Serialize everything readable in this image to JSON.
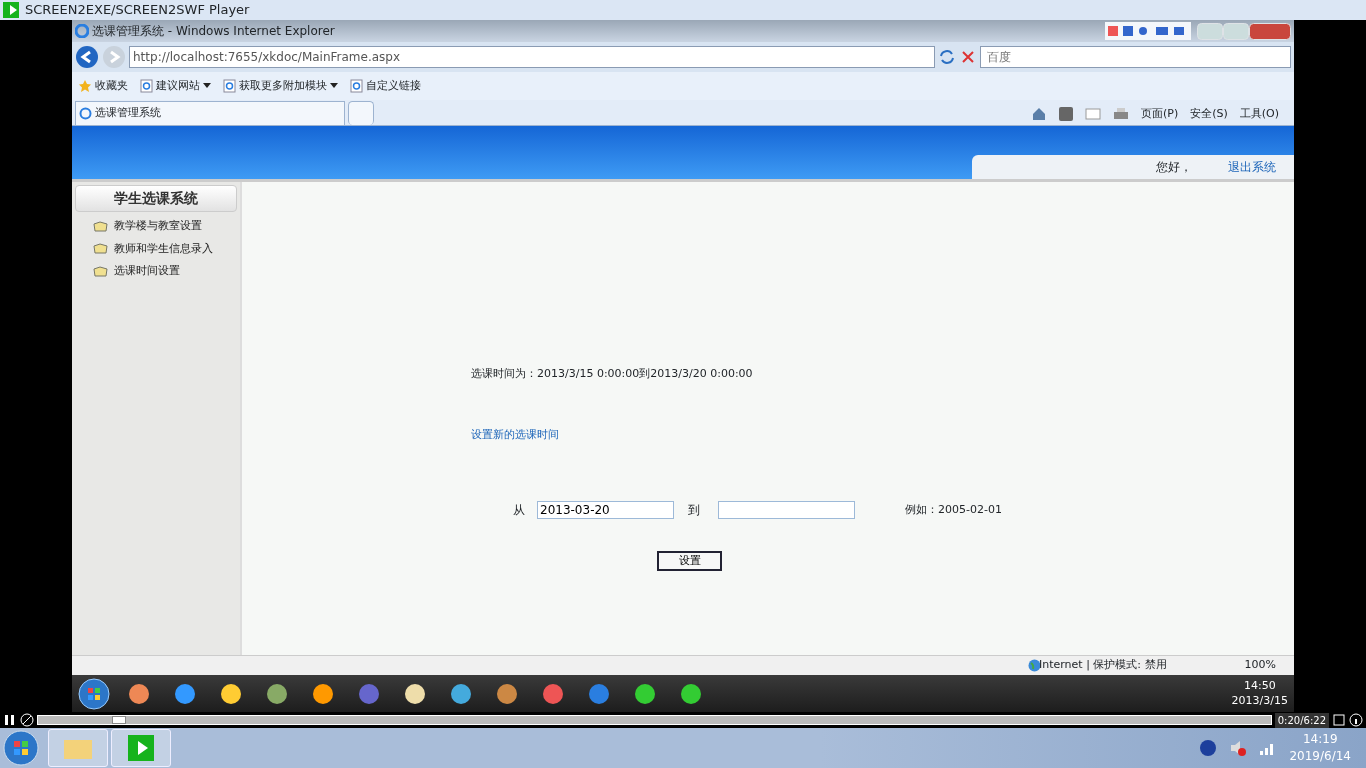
{
  "player": {
    "title": "SCREEN2EXE/SCREEN2SWF Player",
    "progress": {
      "level": 0.06
    },
    "time": "0:20/6:22"
  },
  "browser": {
    "title": "选课管理系统 - Windows Internet Explorer",
    "url": "http://localhost:7655/xkdoc/MainFrame.aspx",
    "search": {
      "placeholder": "百度"
    },
    "favorites": [
      {
        "label": "收藏夹",
        "kind": "star"
      },
      {
        "label": "建议网站",
        "kind": "dropdown"
      },
      {
        "label": "获取更多附加模块",
        "kind": "dropdown"
      },
      {
        "label": "自定义链接",
        "kind": "link"
      }
    ],
    "tabs": [
      {
        "label": "选课管理系统",
        "selected": true
      }
    ],
    "commands": [
      "页面(P)",
      "安全(S)",
      "工具(O)"
    ],
    "status": {
      "zone": "Internet | 保护模式: 禁用",
      "zoom": "100%"
    }
  },
  "page": {
    "greeting": "您好，",
    "logout": "退出系统",
    "sidebar": {
      "title": "学生选课系统",
      "items": [
        {
          "label": "教学楼与教室设置"
        },
        {
          "label": "教师和学生信息录入"
        },
        {
          "label": "选课时间设置"
        }
      ]
    },
    "current_time": "选课时间为：2013/3/15 0:00:00到2013/3/20 0:00:00",
    "new_time_link": "设置新的选课时间",
    "form": {
      "from_label": "从",
      "from_value": "2013-03-20",
      "to_label": "到",
      "example": "例如：2005-02-01",
      "submit": "设置"
    }
  },
  "guest_taskbar": {
    "time": "14:50",
    "date": "2013/3/15"
  },
  "host_taskbar": {
    "time": "14:19",
    "date": "2019/6/14"
  }
}
